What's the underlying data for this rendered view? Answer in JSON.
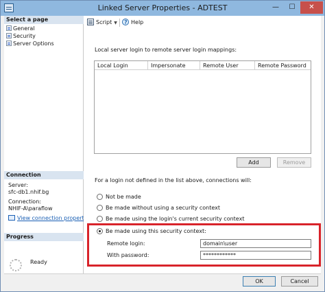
{
  "window": {
    "title": "Linked Server Properties - ADTEST",
    "min_glyph": "—",
    "max_glyph": "☐",
    "close_glyph": "✕"
  },
  "left_pane": {
    "select_page_header": "Select a page",
    "pages": [
      {
        "label": "General",
        "icon": "page-icon"
      },
      {
        "label": "Security",
        "icon": "page-icon"
      },
      {
        "label": "Server Options",
        "icon": "page-icon"
      }
    ],
    "connection_header": "Connection",
    "server_label": "Server:",
    "server_value": "sfc-db1.nhif.bg",
    "connection_label": "Connection:",
    "connection_value": "NHIF-A\\paraflow",
    "view_connection_link": "View connection properties",
    "progress_header": "Progress",
    "progress_status": "Ready"
  },
  "toolbar": {
    "script_label": "Script",
    "help_label": "Help",
    "chevron": "▼"
  },
  "mapping": {
    "label": "Local server login to remote server login mappings:",
    "columns": [
      "Local Login",
      "Impersonate",
      "Remote User",
      "Remote Password"
    ],
    "rows": [],
    "add_label": "Add",
    "remove_label": "Remove"
  },
  "not_defined": {
    "label": "For a login not defined in the list above, connections will:",
    "options": [
      {
        "label": "Not be made",
        "checked": false
      },
      {
        "label": "Be made without using a security context",
        "checked": false
      },
      {
        "label": "Be made using the login's current security context",
        "checked": false
      },
      {
        "label": "Be made using this security context:",
        "checked": true
      }
    ]
  },
  "security_context": {
    "remote_login_label": "Remote login:",
    "remote_login_value": "domain\\user",
    "password_label": "With password:",
    "password_value": "************"
  },
  "footer": {
    "ok_label": "OK",
    "cancel_label": "Cancel"
  },
  "colors": {
    "title_bar": "#8fb8df",
    "highlight_border": "#d8232a",
    "link": "#1a5fb4",
    "close_button": "#c7504b"
  }
}
